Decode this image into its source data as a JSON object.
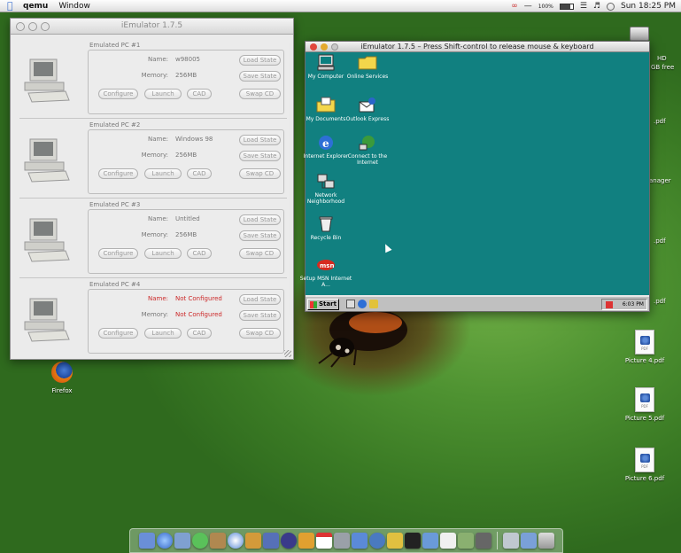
{
  "menubar": {
    "app": "qemu",
    "items": [
      "Window"
    ],
    "battery": "100%",
    "clock": "Sun 18:25 PM"
  },
  "list_window": {
    "title": "iEmulator 1.7.5",
    "pcs": [
      {
        "caption": "Emulated PC #1",
        "name_label": "Name:",
        "name": "w98005",
        "memory_label": "Memory:",
        "memory": "256MB",
        "configured": true
      },
      {
        "caption": "Emulated PC #2",
        "name_label": "Name:",
        "name": "Windows 98",
        "memory_label": "Memory:",
        "memory": "256MB",
        "configured": true
      },
      {
        "caption": "Emulated PC #3",
        "name_label": "Name:",
        "name": "Untitled",
        "memory_label": "Memory:",
        "memory": "256MB",
        "configured": true
      },
      {
        "caption": "Emulated PC #4",
        "name_label": "Name:",
        "name": "Not Configured",
        "memory_label": "Memory:",
        "memory": "Not Configured",
        "configured": false
      }
    ],
    "buttons": {
      "load_state": "Load State",
      "save_state": "Save State",
      "configure": "Configure",
      "launch": "Launch",
      "cad": "CAD",
      "swap_cd": "Swap CD"
    }
  },
  "guest_window": {
    "title": "iEmulator 1.7.5 – Press Shift-control to release mouse & keyboard",
    "desktop_icons": [
      {
        "label": "My Computer",
        "icon": "computer-icon"
      },
      {
        "label": "Online Services",
        "icon": "folder-icon"
      },
      {
        "label": "My Documents",
        "icon": "documents-folder-icon"
      },
      {
        "label": "Outlook Express",
        "icon": "outlook-icon"
      },
      {
        "label": "Internet Explorer",
        "icon": "ie-icon"
      },
      {
        "label": "Connect to the Internet",
        "icon": "connect-icon"
      },
      {
        "label": "Network Neighborhood",
        "icon": "network-icon"
      },
      {
        "label": "Recycle Bin",
        "icon": "recycle-bin-icon"
      },
      {
        "label": "Setup MSN Internet A...",
        "icon": "msn-icon"
      }
    ],
    "taskbar": {
      "start_label": "Start",
      "clock": "6:03 PM"
    }
  },
  "desktop": {
    "hd_label": "HD",
    "hd_free": "GB free",
    "right_labels": [
      ".pdf",
      "anager",
      ".pdf",
      ".pdf"
    ],
    "firefox_label": "Firefox",
    "pdf_icons": [
      "Picture 4.pdf",
      "Picture 5.pdf",
      "Picture 6.pdf"
    ]
  },
  "colors": {
    "guest_desktop": "#118080",
    "not_configured": "#cc2a2a",
    "mac_desktop": "#4e9231"
  }
}
